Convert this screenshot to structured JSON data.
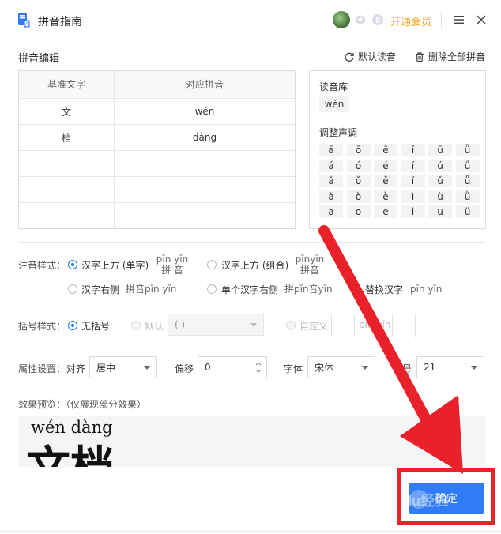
{
  "window": {
    "title": "拼音指南",
    "vip_label": "开通会员"
  },
  "editor": {
    "section_title": "拼音编辑",
    "reset_label": "默认读音",
    "delete_label": "删除全部拼音",
    "table": {
      "headers": [
        "基准文字",
        "对应拼音"
      ],
      "rows": [
        {
          "char": "文",
          "pinyin": "wén"
        },
        {
          "char": "档",
          "pinyin": "dàng"
        },
        {
          "char": "",
          "pinyin": ""
        },
        {
          "char": "",
          "pinyin": ""
        },
        {
          "char": "",
          "pinyin": ""
        }
      ]
    }
  },
  "tone_panel": {
    "library_label": "读音库",
    "library_value": "wén",
    "adjust_label": "调整声调",
    "tones": [
      [
        "ā",
        "ō",
        "ē",
        "ī",
        "ū",
        "ǖ"
      ],
      [
        "á",
        "ó",
        "é",
        "í",
        "ú",
        "ǘ"
      ],
      [
        "ǎ",
        "ǒ",
        "ě",
        "ǐ",
        "ǔ",
        "ǚ"
      ],
      [
        "à",
        "ò",
        "è",
        "ì",
        "ù",
        "ǜ"
      ],
      [
        "a",
        "o",
        "e",
        "i",
        "u",
        "ü"
      ]
    ]
  },
  "options": {
    "style_label": "注音样式：",
    "style_opts": [
      {
        "label": "汉字上方 (单字)",
        "example_top": "pīn yīn",
        "example_bottom": "拼  音",
        "selected": true
      },
      {
        "label": "汉字上方 (组合)",
        "example_top": "pīnyīn",
        "example_bottom": "拼音",
        "selected": false
      },
      {
        "label": "汉字右侧",
        "example": "拼音pīn yīn",
        "selected": false
      },
      {
        "label": "单个汉字右侧",
        "example": "拼pīn音yīn",
        "selected": false
      },
      {
        "label": "替换汉字",
        "example": "pīn yīn",
        "selected": false
      }
    ],
    "bracket_label": "括号样式：",
    "bracket_none": "无括号",
    "bracket_default": "默认",
    "bracket_default_value": "( )",
    "bracket_custom": "自定义",
    "bracket_custom_example": "pīn yīn",
    "attr_label": "属性设置：",
    "align_label": "对齐",
    "align_value": "居中",
    "offset_label": "偏移",
    "offset_value": "0",
    "font_label": "字体",
    "font_value": "宋体",
    "size_label": "字号",
    "size_value": "21"
  },
  "preview": {
    "label": "效果预览：（仅展现部分效果）",
    "pinyin": "wén dàng",
    "chars": "文档"
  },
  "footer": {
    "confirm_label": "确定",
    "watermark": "Baidu经验"
  },
  "colors": {
    "accent": "#1677ff",
    "confirm": "#2f7cf6",
    "vip": "#f5a623",
    "annotation": "#e8212a"
  }
}
